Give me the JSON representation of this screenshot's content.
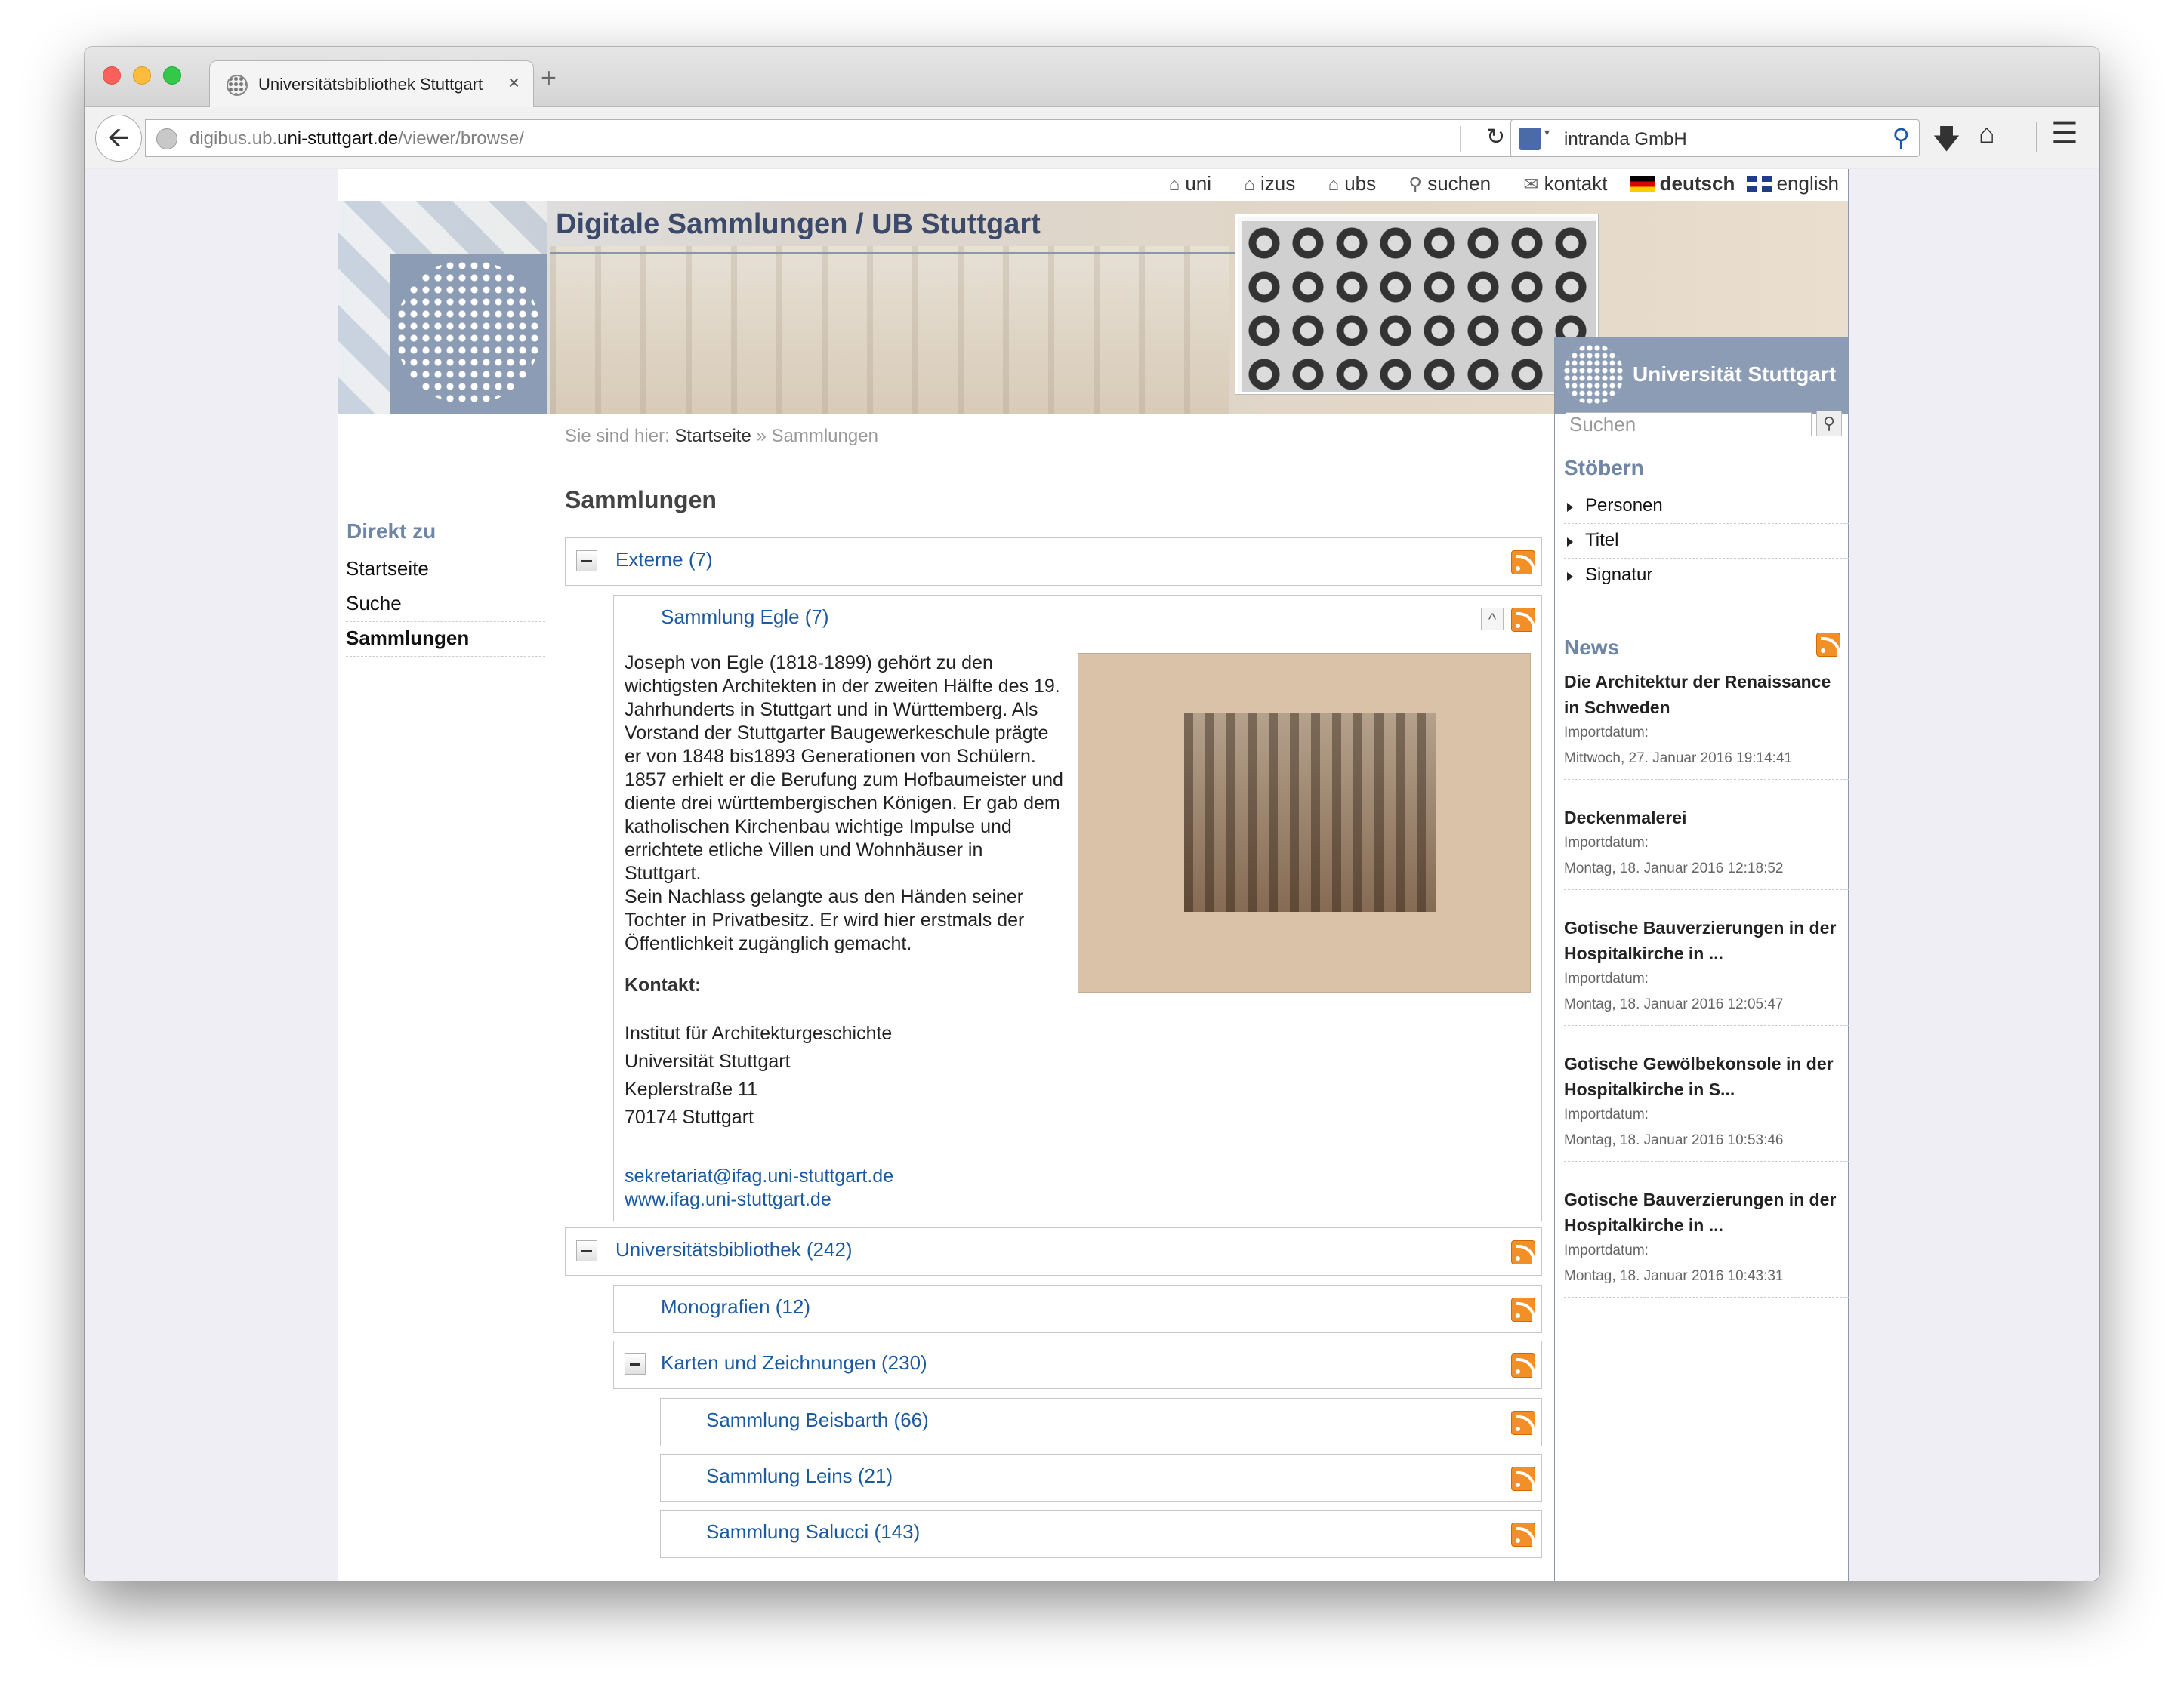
{
  "browser": {
    "tab_title": "Universitätsbibliothek Stuttgart",
    "url_prefix": "digibus.ub.",
    "url_domain": "uni-stuttgart.de",
    "url_path": "/viewer/browse/",
    "search_engine_text": "intranda GmbH",
    "traffic_lights": [
      "#fc605c",
      "#fdbc40",
      "#34c84a"
    ]
  },
  "topnav": {
    "uni": "uni",
    "izus": "izus",
    "ubs": "ubs",
    "suchen": "suchen",
    "kontakt": "kontakt",
    "deutsch": "deutsch",
    "english": "english"
  },
  "header": {
    "title": "Digitale Sammlungen / UB Stuttgart",
    "uni_logo_text": "Universität Stuttgart"
  },
  "left": {
    "heading": "Direkt zu",
    "items": [
      "Startseite",
      "Suche",
      "Sammlungen"
    ]
  },
  "breadcrumb": {
    "prefix": "Sie sind hier:",
    "start": "Startseite",
    "current": "» Sammlungen"
  },
  "main": {
    "heading": "Sammlungen",
    "collections": {
      "externe": "Externe (7)",
      "egle": "Sammlung Egle (7)",
      "ub": "Universitätsbibliothek (242)",
      "monografien": "Monografien (12)",
      "karten": "Karten und Zeichnungen (230)",
      "beisbarth": "Sammlung Beisbarth (66)",
      "leins": "Sammlung Leins (21)",
      "salucci": "Sammlung Salucci (143)"
    },
    "egle_description": "Joseph von Egle (1818-1899) gehört zu den wichtigsten Architekten in der zweiten Hälfte des 19. Jahrhunderts in Stuttgart und in Württemberg. Als Vorstand der Stuttgarter Baugewerkeschule prägte er von 1848 bis1893 Generationen von Schülern. 1857 erhielt er die Berufung zum Hofbaumeister und diente drei württembergischen Königen. Er gab dem katholischen Kirchenbau wichtige Impulse und errichtete etliche Villen und Wohnhäuser in Stuttgart.",
    "egle_description_2": "Sein Nachlass gelangte aus den Händen seiner Tochter in Privatbesitz. Er wird hier erstmals der Öffentlichkeit zugänglich gemacht.",
    "contact_label": "Kontakt:",
    "contact_lines": [
      "Institut für Architekturgeschichte",
      "Universität Stuttgart",
      "Keplerstraße 11",
      "70174 Stuttgart"
    ],
    "contact_email": "sekretariat@ifag.uni-stuttgart.de",
    "contact_web": "www.ifag.uni-stuttgart.de"
  },
  "right": {
    "search_placeholder": "Suchen",
    "browse_heading": "Stöbern",
    "browse_items": [
      "Personen",
      "Titel",
      "Signatur"
    ],
    "news_heading": "News",
    "import_label": "Importdatum:",
    "news": [
      {
        "title": "Die Architektur der Renaissance in Schweden",
        "date": "Mittwoch, 27. Januar 2016 19:14:41"
      },
      {
        "title": "Deckenmalerei",
        "date": "Montag, 18. Januar 2016 12:18:52"
      },
      {
        "title": "Gotische Bauverzierungen in der Hospitalkirche in ...",
        "date": "Montag, 18. Januar 2016 12:05:47"
      },
      {
        "title": "Gotische Gewölbekonsole in der Hospitalkirche in S...",
        "date": "Montag, 18. Januar 2016 10:53:46"
      },
      {
        "title": "Gotische Bauverzierungen in der Hospitalkirche in ...",
        "date": "Montag, 18. Januar 2016 10:43:31"
      }
    ]
  }
}
